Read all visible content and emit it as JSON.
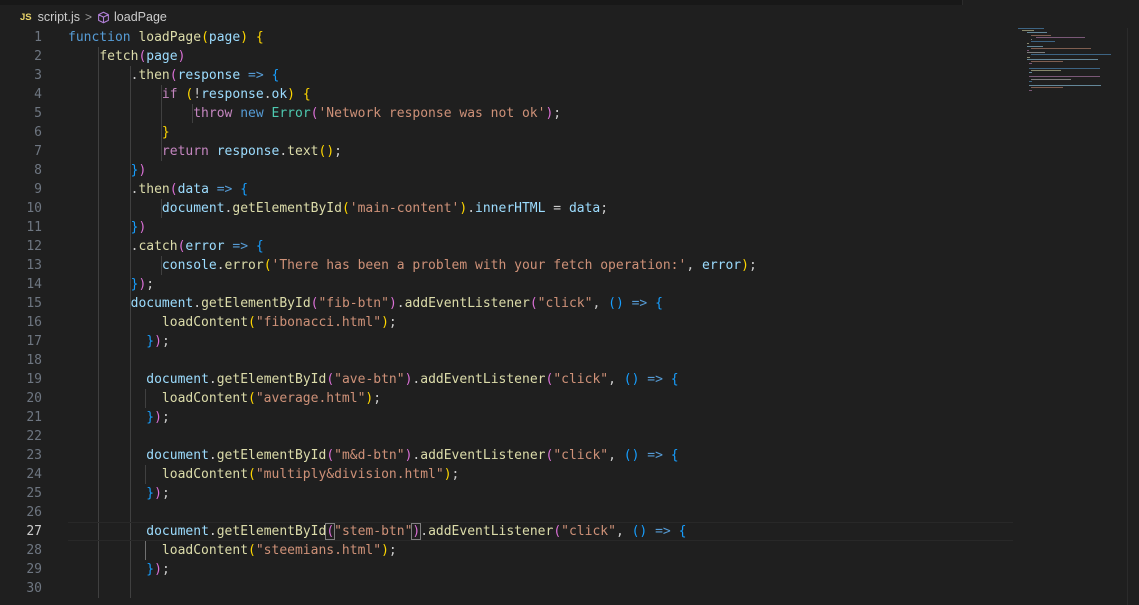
{
  "breadcrumb": {
    "lang_badge": "JS",
    "file": "script.js",
    "separator": ">",
    "symbol": "loadPage"
  },
  "editor": {
    "current_line": 27,
    "line_numbers": [
      "1",
      "2",
      "3",
      "4",
      "5",
      "6",
      "7",
      "8",
      "9",
      "10",
      "11",
      "12",
      "13",
      "14",
      "15",
      "16",
      "17",
      "18",
      "19",
      "20",
      "21",
      "22",
      "23",
      "24",
      "25",
      "26",
      "27",
      "28",
      "29",
      "30"
    ],
    "lines": [
      "function loadPage(page) {",
      "    fetch(page)",
      "        .then(response => {",
      "            if (!response.ok) {",
      "                throw new Error('Network response was not ok');",
      "            }",
      "            return response.text();",
      "        })",
      "        .then(data => {",
      "            document.getElementById('main-content').innerHTML = data;",
      "        })",
      "        .catch(error => {",
      "            console.error('There has been a problem with your fetch operation:', error);",
      "        });",
      "        document.getElementById(\"fib-btn\").addEventListener(\"click\", () => {",
      "            loadContent(\"fibonacci.html\");",
      "          });",
      "",
      "          document.getElementById(\"ave-btn\").addEventListener(\"click\", () => {",
      "            loadContent(\"average.html\");",
      "          });",
      "",
      "          document.getElementById(\"m&d-btn\").addEventListener(\"click\", () => {",
      "            loadContent(\"multiply&division.html\");",
      "          });",
      "",
      "          document.getElementById(\"stem-btn\").addEventListener(\"click\", () => {",
      "            loadContent(\"steemians.html\");",
      "          });",
      ""
    ]
  },
  "colors": {
    "background": "#1f1f1f",
    "keyword": "#569cd6",
    "control_keyword": "#c586c0",
    "function": "#dcdcaa",
    "variable": "#9cdcfe",
    "string": "#ce9178",
    "type": "#4ec9b0",
    "bracket_1": "#ffd700",
    "bracket_2": "#da70d6",
    "bracket_3": "#179fff"
  }
}
